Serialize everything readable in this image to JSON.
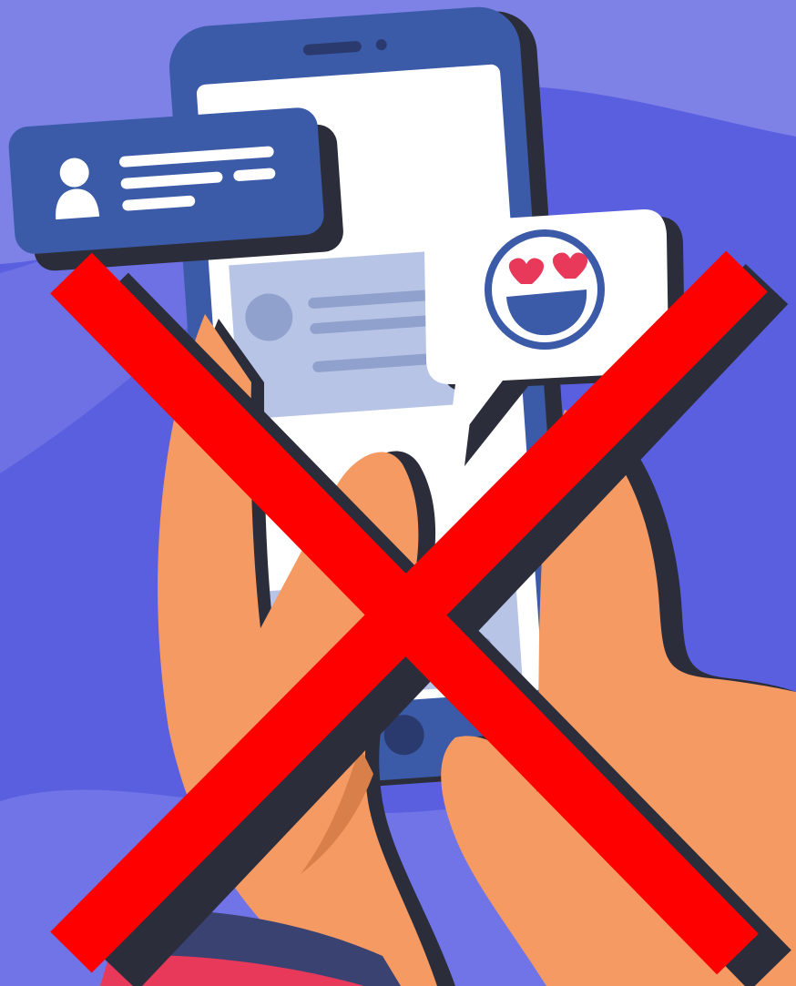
{
  "illustration": {
    "background_color": "#5a5fe0",
    "background_wave_color": "#7e82e6",
    "phone_color": "#3b5ba8",
    "screen_color": "#ffffff",
    "skin_color": "#f59a63",
    "outline_color": "#2b2d3a",
    "cross_color": "#ff0000",
    "emoji": {
      "icon": "heart-eyes-emoji-icon",
      "heart_color": "#e8395b"
    },
    "notification": {
      "icon": "user-avatar-icon",
      "color": "#3b5ba8"
    }
  }
}
